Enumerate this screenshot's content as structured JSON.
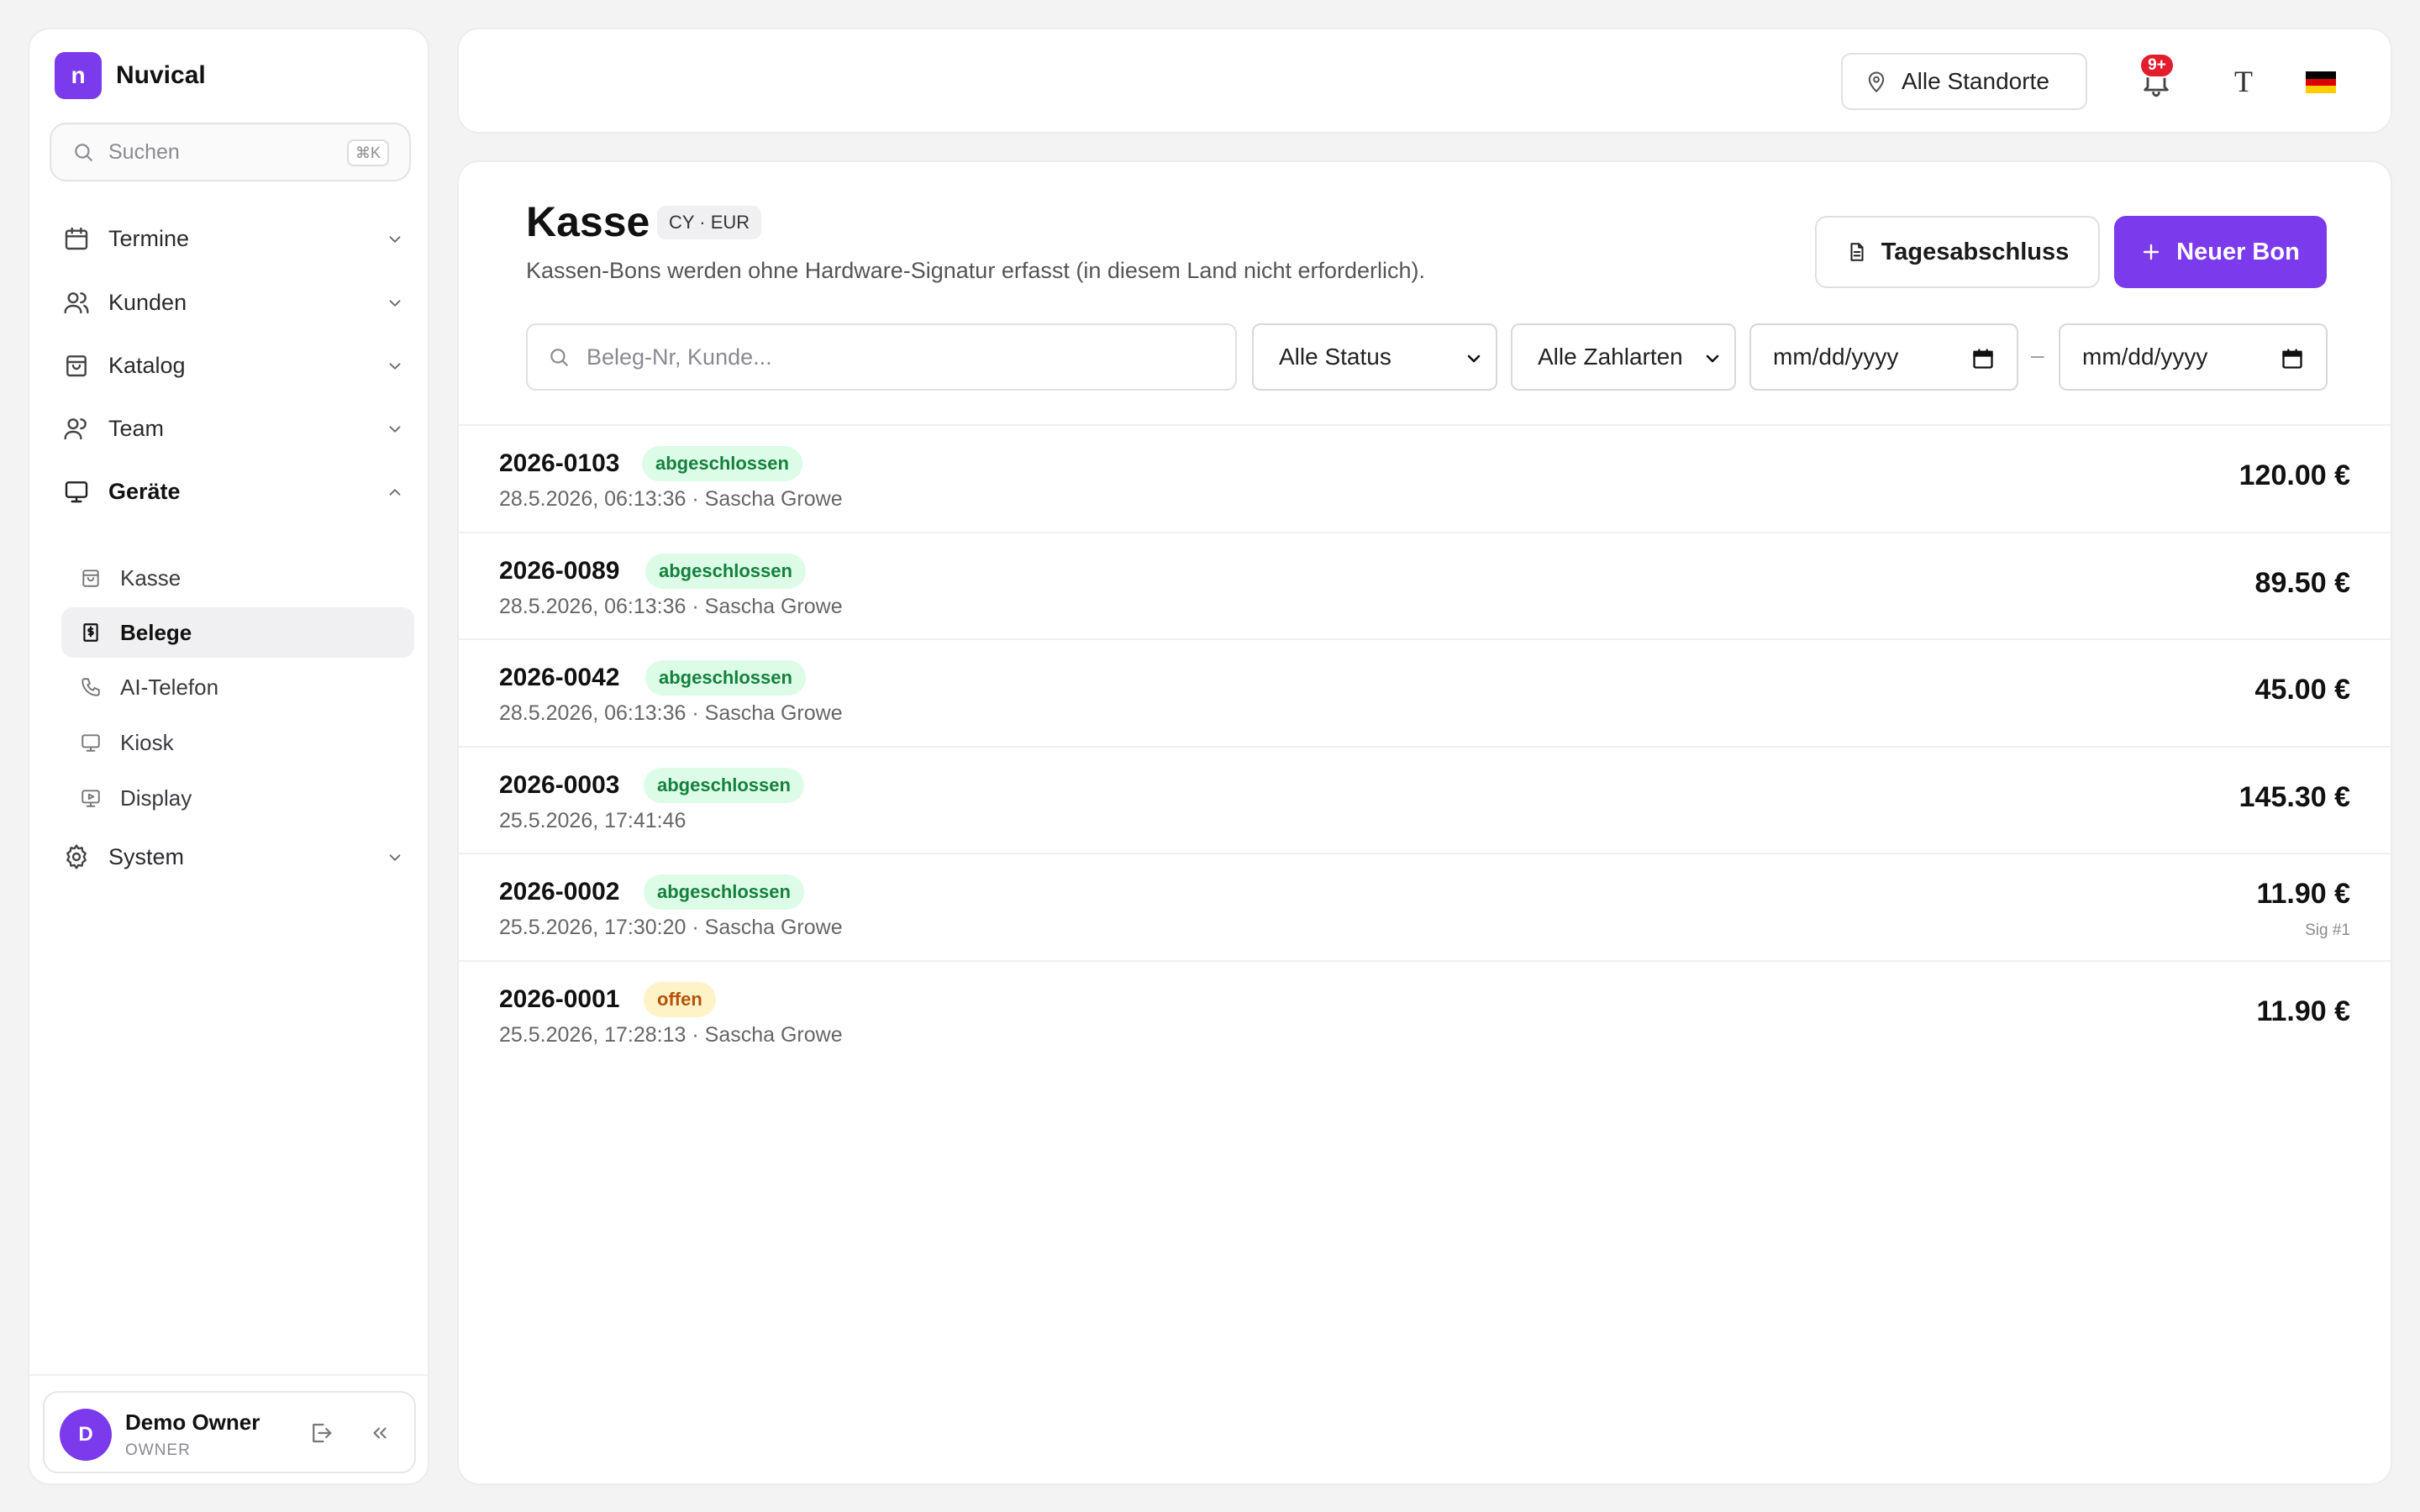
{
  "app": {
    "logo_letter": "n",
    "name": "Nuvical"
  },
  "sidebar": {
    "search_placeholder": "Suchen",
    "search_shortcut": "⌘K",
    "nav": [
      {
        "label": "Termine",
        "icon": "calendar-icon"
      },
      {
        "label": "Kunden",
        "icon": "users-icon"
      },
      {
        "label": "Katalog",
        "icon": "shopping-bag-icon"
      },
      {
        "label": "Team",
        "icon": "team-icon"
      },
      {
        "label": "Geräte",
        "icon": "monitor-icon",
        "expanded": true
      },
      {
        "label": "System",
        "icon": "gear-icon"
      }
    ],
    "sub_items": [
      {
        "label": "Kasse",
        "icon": "cash-register-icon"
      },
      {
        "label": "Belege",
        "icon": "receipt-icon",
        "active": true
      },
      {
        "label": "AI-Telefon",
        "icon": "phone-icon"
      },
      {
        "label": "Kiosk",
        "icon": "monitor-icon"
      },
      {
        "label": "Display",
        "icon": "display-icon"
      }
    ],
    "user": {
      "initial": "D",
      "name": "Demo Owner",
      "role": "OWNER"
    }
  },
  "topbar": {
    "location_label": "Alle Standorte",
    "notification_count": "9+",
    "font_toggle": "T",
    "language_flag": "flag-de-icon"
  },
  "page": {
    "title": "Kasse",
    "currency_badge": "CY · EUR",
    "subtitle": "Kassen-Bons werden ohne Hardware-Signatur erfasst (in diesem Land nicht erforderlich).",
    "daily_close_label": "Tagesabschluss",
    "new_receipt_label": "Neuer Bon"
  },
  "filters": {
    "search_placeholder": "Beleg-Nr, Kunde...",
    "status_selected": "Alle Status",
    "payment_selected": "Alle Zahlarten",
    "date_from_placeholder": "mm/dd/yyyy",
    "date_separator": "–",
    "date_to_placeholder": "mm/dd/yyyy"
  },
  "receipts": [
    {
      "id": "2026-0103",
      "status": "abgeschlossen",
      "status_kind": "done",
      "meta": "28.5.2026, 06:13:36  · Sascha Growe",
      "amount": "120.00 €",
      "sig": ""
    },
    {
      "id": "2026-0089",
      "status": "abgeschlossen",
      "status_kind": "done",
      "meta": "28.5.2026, 06:13:36  · Sascha Growe",
      "amount": "89.50 €",
      "sig": ""
    },
    {
      "id": "2026-0042",
      "status": "abgeschlossen",
      "status_kind": "done",
      "meta": "28.5.2026, 06:13:36  · Sascha Growe",
      "amount": "45.00 €",
      "sig": ""
    },
    {
      "id": "2026-0003",
      "status": "abgeschlossen",
      "status_kind": "done",
      "meta": "25.5.2026, 17:41:46",
      "amount": "145.30 €",
      "sig": ""
    },
    {
      "id": "2026-0002",
      "status": "abgeschlossen",
      "status_kind": "done",
      "meta": "25.5.2026, 17:30:20  · Sascha Growe",
      "amount": "11.90 €",
      "sig": "Sig #1"
    },
    {
      "id": "2026-0001",
      "status": "offen",
      "status_kind": "open",
      "meta": "25.5.2026, 17:28:13  · Sascha Growe",
      "amount": "11.90 €",
      "sig": ""
    }
  ],
  "colors": {
    "accent": "#7c3aed",
    "badge_red": "#e11d2e",
    "status_done_bg": "#dcfce7",
    "status_done_fg": "#15803d",
    "status_open_bg": "#fef3c7",
    "status_open_fg": "#b45309"
  }
}
